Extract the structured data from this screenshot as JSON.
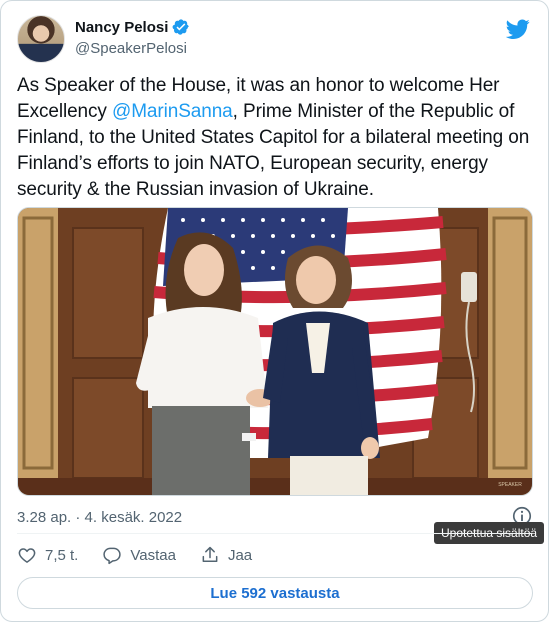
{
  "author": {
    "display_name": "Nancy Pelosi",
    "handle": "@SpeakerPelosi",
    "verified": true
  },
  "tweet": {
    "text_before": "As Speaker of the House, it was an honor to welcome Her Excellency ",
    "mention": "@MarinSanna",
    "text_after": ", Prime Minister of the Republic of Finland, to the United States Capitol for a bilateral meeting on Finland’s efforts to join NATO, European security, energy security & the Russian invasion of Ukraine.",
    "timestamp": "3.28 ap. · 4. kesäk. 2022",
    "tooltip": "Upotettua sisältöä"
  },
  "actions": {
    "like_count": "7,5 t.",
    "reply_label": "Vastaa",
    "share_label": "Jaa"
  },
  "read_replies_label": "Lue 592 vastausta",
  "colors": {
    "accent": "#1d9bf0",
    "text": "#0f1419",
    "muted": "#536471",
    "border": "#cfd9de"
  },
  "icons": [
    "verified-badge-icon",
    "twitter-bird-icon",
    "info-icon",
    "heart-icon",
    "reply-icon",
    "share-icon"
  ]
}
